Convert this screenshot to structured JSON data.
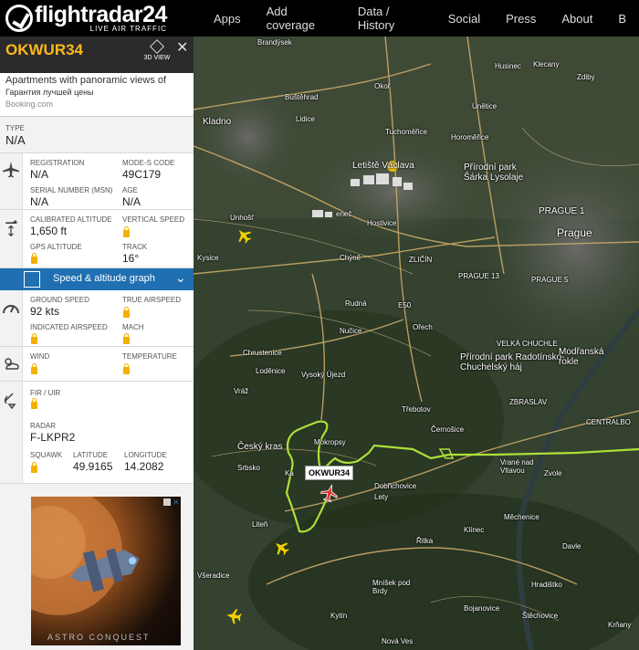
{
  "brand": {
    "name": "flightradar24",
    "tagline": "LIVE AIR TRAFFIC"
  },
  "nav": [
    "Apps",
    "Add coverage",
    "Data / History",
    "Social",
    "Press",
    "About",
    "B"
  ],
  "flight": {
    "callsign": "OKWUR34",
    "view3d_label": "3D VIEW",
    "type_label": "TYPE",
    "type_value": "N/A",
    "registration_label": "REGISTRATION",
    "registration_value": "N/A",
    "modes_label": "MODE-S CODE",
    "modes_value": "49C179",
    "serial_label": "SERIAL NUMBER (MSN)",
    "serial_value": "N/A",
    "age_label": "AGE",
    "age_value": "N/A",
    "cal_alt_label": "CALIBRATED ALTITUDE",
    "cal_alt_value": "1,650 ft",
    "vspeed_label": "VERTICAL SPEED",
    "gps_alt_label": "GPS ALTITUDE",
    "track_label": "TRACK",
    "track_value": "16°",
    "graph_label": "Speed & altitude graph",
    "gspeed_label": "GROUND SPEED",
    "gspeed_value": "92 kts",
    "tas_label": "TRUE AIRSPEED",
    "ias_label": "INDICATED AIRSPEED",
    "mach_label": "MACH",
    "wind_label": "WIND",
    "temp_label": "TEMPERATURE",
    "fir_label": "FIR / UIR",
    "radar_label": "RADAR",
    "radar_value": "F-LKPR2",
    "squawk_label": "SQUAWK",
    "lat_label": "LATITUDE",
    "lat_value": "49.9165",
    "lon_label": "LONGITUDE",
    "lon_value": "14.2082"
  },
  "ad_top": {
    "line1": "Apartments with panoramic views of",
    "line2": "Гарантия лучшей цены",
    "line3": "Booking.com"
  },
  "ad_bottom": {
    "caption": "ASTRO CONQUEST"
  },
  "map": {
    "aircraft_tag": "OKWUR34",
    "places": {
      "brandysek": "Brandýsek",
      "husinec": "Husinec",
      "klecany": "Klecany",
      "zdiby": "Zdiby",
      "bustehrad": "Buštěhrad",
      "okor": "Okoř",
      "unetice": "Únětice",
      "kladno": "Kladno",
      "lidice": "Lidice",
      "tuchomerice": "Tuchoměřice",
      "horomerice": "Horoměřice",
      "airport": "Letiště Václava",
      "sarka": "Přírodní park Šárka Lysolaje",
      "unhost": "Unhošť",
      "senec": "eneč",
      "hostivice": "Hostivice",
      "prague1": "PRAGUE 1",
      "prague": "Prague",
      "kysice": "Kysice",
      "chyne": "Chýně",
      "zlicin": "ZLIČÍN",
      "prague13": "PRAGUE 13",
      "prague5": "PRAGUE 5",
      "rudna": "Rudná",
      "orech": "Ořech",
      "nucice": "Nučice",
      "velka": "VELKÁ CHUCHLE",
      "chrustenice": "Chrustenice",
      "radotin": "Přírodní park Radotínsko-Chuchelský háj",
      "modranska": "Modřanská rokle",
      "lodenice": "Loděnice",
      "vysokyujezd": "Vysoký Újezd",
      "vraz": "Vráž",
      "zbraslav": "ZBRASLAV",
      "trebotov": "Třebotov",
      "cernosice": "Černošice",
      "ceskykras": "Český kras",
      "mokropsy": "Mokropsy",
      "srbsko": "Srbsko",
      "dobrichovice": "Dobřichovice",
      "lety": "Lety",
      "vrane": "Vrané nad Vltavou",
      "zvole": "Zvole",
      "centralbo": "CENTRALBO",
      "liten": "Liteň",
      "klinec": "Klínec",
      "mechenice": "Měchenice",
      "ritka": "Řitka",
      "davle": "Davle",
      "vseradice": "Všeradice",
      "mnisek": "Mníšek pod Brdy",
      "hradistko": "Hradištko",
      "bojanovice": "Bojanovice",
      "stechovice": "Štěchovice",
      "kytin": "Kytín",
      "novaves": "Nová Ves",
      "krnany": "Krňany",
      "ka": "Ka",
      "e50": "E50"
    }
  }
}
